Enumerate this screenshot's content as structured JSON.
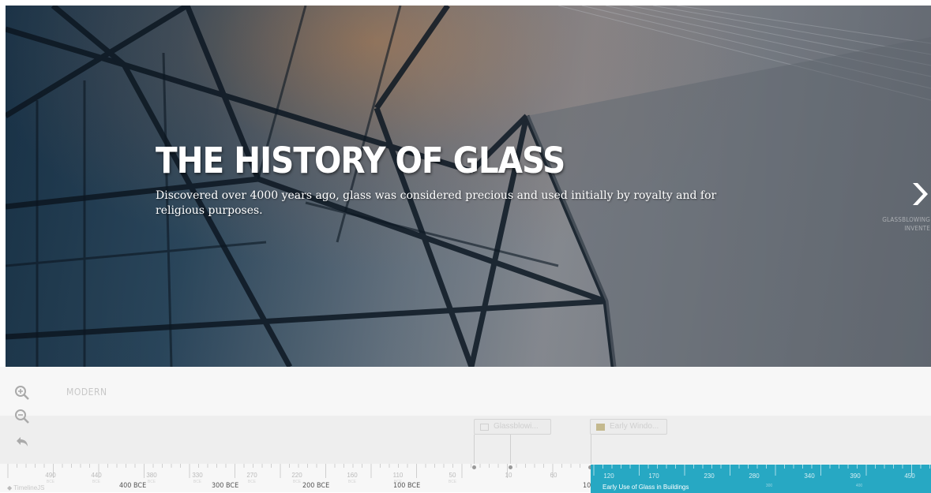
{
  "slide": {
    "headline": "THE HISTORY OF GLASS",
    "description": "Discovered over 4000 years ago, glass was considered precious and used initially by royalty and for religious purposes.",
    "next_label": "GLASSBLOWING INVENTE"
  },
  "navigator": {
    "era_label": "MODERN",
    "markers": [
      {
        "label": "Glassblowi..."
      },
      {
        "label": "Early Windo..."
      }
    ],
    "active_era_label": "Early Use of Glass in Buildings",
    "branding": "TimelineJS",
    "axis": {
      "major_labels": [
        "400 BCE",
        "300 BCE",
        "200 BCE",
        "100 BCE",
        "10"
      ],
      "minor_labels": [
        "490",
        "440",
        "380",
        "330",
        "270",
        "220",
        "160",
        "110",
        "50",
        "10",
        "60"
      ],
      "minor_sublabel": "BCE",
      "active_minor_labels": [
        "120",
        "170",
        "230",
        "280",
        "340",
        "390",
        "450"
      ],
      "active_sublabels": [
        "300",
        "400"
      ]
    }
  },
  "icons": {
    "zoom_in": "zoom-in-icon",
    "zoom_out": "zoom-out-icon",
    "back": "back-arrow-icon",
    "next": "chevron-right-icon"
  },
  "colors": {
    "accent": "#27a8c3",
    "headline": "#ffffff",
    "nav_bg": "#f4f4f4"
  }
}
